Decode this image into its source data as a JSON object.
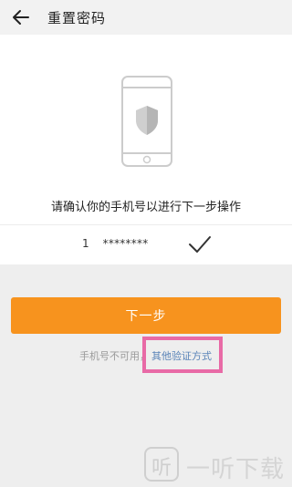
{
  "header": {
    "title": "重置密码",
    "back_icon": "arrow-left-icon"
  },
  "main": {
    "illustration_icon": "phone-shield-icon",
    "prompt": "请确认你的手机号以进行下一步操作",
    "phone": {
      "prefix": "1",
      "masked": "********",
      "confirm_icon": "check-icon"
    }
  },
  "next_button": {
    "label": "下一步"
  },
  "alternative": {
    "text": "手机号不可用，",
    "link": "其他验证方式"
  },
  "watermark": {
    "logo_text": "听",
    "text": "一听下载"
  },
  "colors": {
    "accent": "#f7931e",
    "link": "#5a84b8",
    "highlight": "#e86aa6",
    "background": "#eeeeee"
  }
}
